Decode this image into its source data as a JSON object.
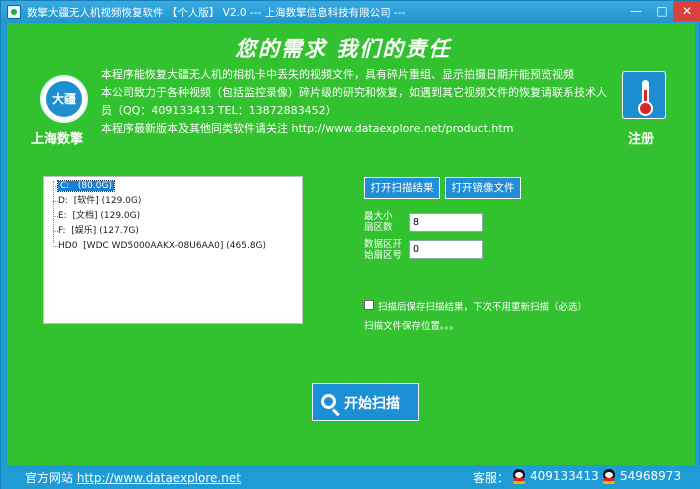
{
  "window": {
    "title": "数擎大疆无人机视频恢复软件  【个人版】 V2.0  --- 上海数擎信息科技有限公司 ---",
    "minimize": "—",
    "maximize": "□",
    "close": "✕"
  },
  "header": {
    "slogan": "您的需求   我们的责任",
    "logo_text": "大疆",
    "company": "上海数擎",
    "description": [
      "本程序能恢复大疆无人机的相机卡中丢失的视频文件，具有碎片重组、显示拍摄日期并能预览视频",
      "本公司致力于各种视频（包括监控录像）碎片级的研究和恢复，如遇到其它视频文件的恢复请联系技术人员（QQ：409133413  TEL：13872883452）",
      "本程序最新版本及其他同类软件请关注 http://www.dataexplore.net/product.htm"
    ],
    "register_label": "注册",
    "register_icon": "thermometer-icon"
  },
  "drives": [
    {
      "name": "C:",
      "label": "",
      "size": "(80.0G)",
      "selected": true
    },
    {
      "name": "D:",
      "label": "[软件]",
      "size": "(129.0G)",
      "selected": false
    },
    {
      "name": "E:",
      "label": "[文档]",
      "size": "(129.0G)",
      "selected": false
    },
    {
      "name": "F:",
      "label": "[娱乐]",
      "size": "(127.7G)",
      "selected": false
    },
    {
      "name": "HD0",
      "label": "[WDC WD5000AAKX-08U6AA0]",
      "size": "(465.8G)",
      "selected": false
    }
  ],
  "buttons": {
    "open_result": "打开扫描结果",
    "open_image": "打开镜像文件",
    "start_scan": "开始扫描"
  },
  "fields": {
    "max_sectors_label_1": "最大小",
    "max_sectors_label_2": "扇区数",
    "max_sectors_value": "8",
    "start_sector_label_1": "数据区开",
    "start_sector_label_2": "始扇区号",
    "start_sector_value": "0"
  },
  "options": {
    "save_result_label": "扫描后保存扫描结果，下次不用重新扫描（必选）",
    "save_result_checked": false,
    "save_location": "扫描文件保存位置。。。"
  },
  "footer": {
    "site_label": "官方网站",
    "site_url": "http://www.dataexplore.net",
    "service_label": "客服：",
    "qq1": "409133413",
    "qq2": "54968973"
  }
}
